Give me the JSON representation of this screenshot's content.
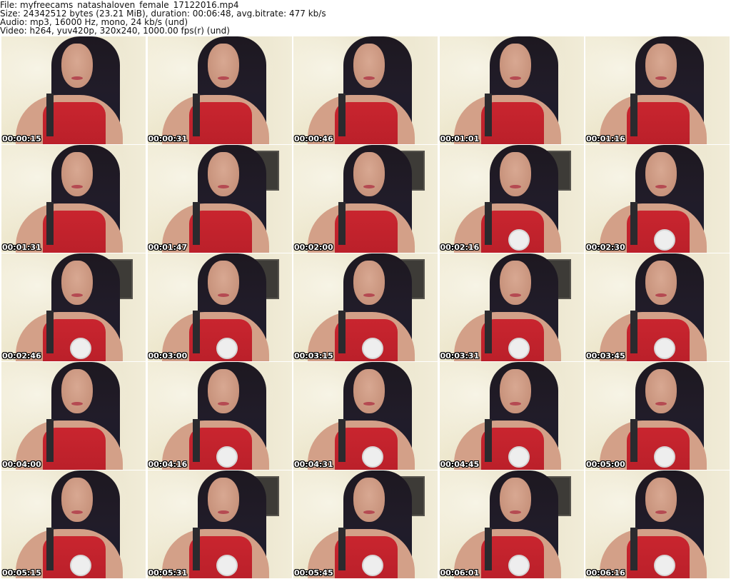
{
  "header": {
    "file_line": "File: myfreecams_natashaloven_female_17122016.mp4",
    "size_line": "Size: 24342512 bytes (23.21 MiB), duration: 00:06:48, avg.bitrate: 477 kb/s",
    "audio_line": "Audio: mp3, 16000 Hz, mono, 24 kb/s (und)",
    "video_line": "Video: h264, yuv420p, 320x240, 1000.00 fps(r) (und)"
  },
  "frames": [
    {
      "timestamp": "00:00:15"
    },
    {
      "timestamp": "00:00:31"
    },
    {
      "timestamp": "00:00:46"
    },
    {
      "timestamp": "00:01:01"
    },
    {
      "timestamp": "00:01:16"
    },
    {
      "timestamp": "00:01:31"
    },
    {
      "timestamp": "00:01:47"
    },
    {
      "timestamp": "00:02:00"
    },
    {
      "timestamp": "00:02:16"
    },
    {
      "timestamp": "00:02:30"
    },
    {
      "timestamp": "00:02:46"
    },
    {
      "timestamp": "00:03:00"
    },
    {
      "timestamp": "00:03:15"
    },
    {
      "timestamp": "00:03:31"
    },
    {
      "timestamp": "00:03:45"
    },
    {
      "timestamp": "00:04:00"
    },
    {
      "timestamp": "00:04:16"
    },
    {
      "timestamp": "00:04:31"
    },
    {
      "timestamp": "00:04:45"
    },
    {
      "timestamp": "00:05:00"
    },
    {
      "timestamp": "00:05:15"
    },
    {
      "timestamp": "00:05:31"
    },
    {
      "timestamp": "00:05:45"
    },
    {
      "timestamp": "00:06:01"
    },
    {
      "timestamp": "00:06:16"
    }
  ],
  "colors": {
    "background": "#ffffff",
    "header_text": "#111111",
    "timestamp_text": "#ffffff",
    "timestamp_outline": "#000000"
  }
}
